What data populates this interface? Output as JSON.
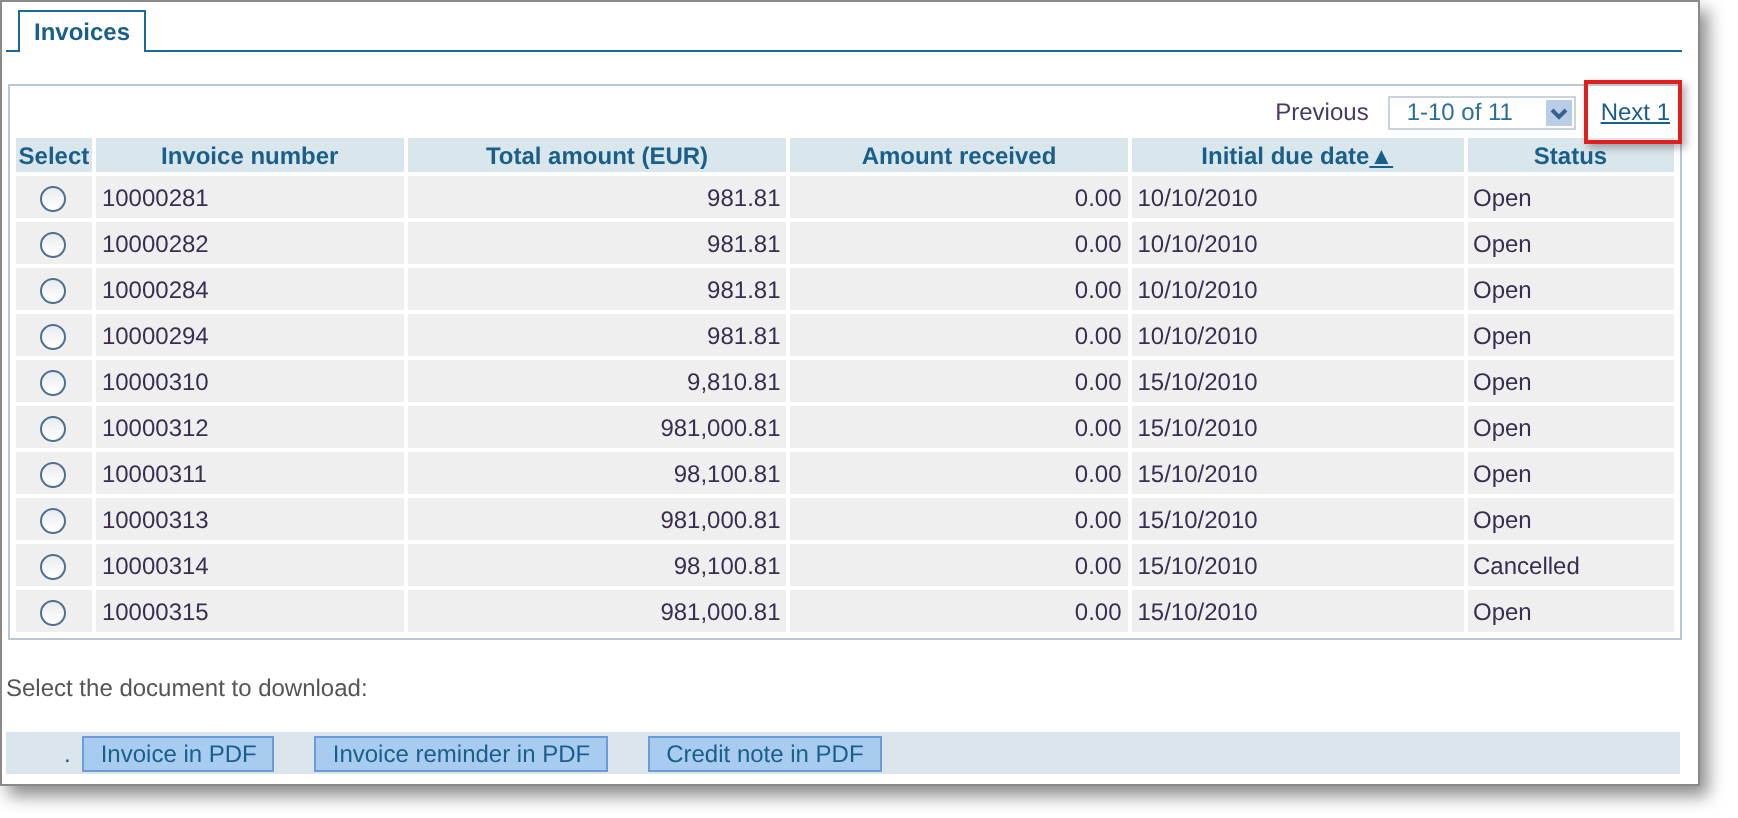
{
  "tabs": [
    {
      "label": "Invoices",
      "selected": true
    }
  ],
  "pager": {
    "previous": "Previous",
    "range": "1-10 of 11",
    "next": "Next 1",
    "next_highlighted": true
  },
  "table": {
    "columns": [
      {
        "label": "Select"
      },
      {
        "label": "Invoice number"
      },
      {
        "label": "Total amount (EUR)"
      },
      {
        "label": "Amount received"
      },
      {
        "label": "Initial due date",
        "sort_icon": "▲"
      },
      {
        "label": "Status"
      }
    ],
    "rows": [
      {
        "cells": [
          {
            "kind": "radio",
            "selected": false
          },
          "10000281",
          "981.81",
          "0.00",
          "10/10/2010",
          "Open"
        ]
      },
      {
        "cells": [
          {
            "kind": "radio",
            "selected": false
          },
          "10000282",
          "981.81",
          "0.00",
          "10/10/2010",
          "Open"
        ]
      },
      {
        "cells": [
          {
            "kind": "radio",
            "selected": false
          },
          "10000284",
          "981.81",
          "0.00",
          "10/10/2010",
          "Open"
        ]
      },
      {
        "cells": [
          {
            "kind": "radio",
            "selected": false
          },
          "10000294",
          "981.81",
          "0.00",
          "10/10/2010",
          "Open"
        ]
      },
      {
        "cells": [
          {
            "kind": "radio",
            "selected": false
          },
          "10000310",
          "9,810.81",
          "0.00",
          "15/10/2010",
          "Open"
        ]
      },
      {
        "cells": [
          {
            "kind": "radio",
            "selected": false
          },
          "10000312",
          "981,000.81",
          "0.00",
          "15/10/2010",
          "Open"
        ]
      },
      {
        "cells": [
          {
            "kind": "radio",
            "selected": false
          },
          "10000311",
          "98,100.81",
          "0.00",
          "15/10/2010",
          "Open"
        ]
      },
      {
        "cells": [
          {
            "kind": "radio",
            "selected": false
          },
          "10000313",
          "981,000.81",
          "0.00",
          "15/10/2010",
          "Open"
        ]
      },
      {
        "cells": [
          {
            "kind": "radio",
            "selected": false
          },
          "10000314",
          "98,100.81",
          "0.00",
          "15/10/2010",
          "Cancelled"
        ]
      },
      {
        "cells": [
          {
            "kind": "radio",
            "selected": false
          },
          "10000315",
          "981,000.81",
          "0.00",
          "15/10/2010",
          "Open"
        ]
      }
    ]
  },
  "download": {
    "prompt": "Select the document to download:",
    "marker": ".",
    "buttons": [
      "Invoice in PDF",
      "Invoice reminder in PDF",
      "Credit note in PDF"
    ]
  }
}
